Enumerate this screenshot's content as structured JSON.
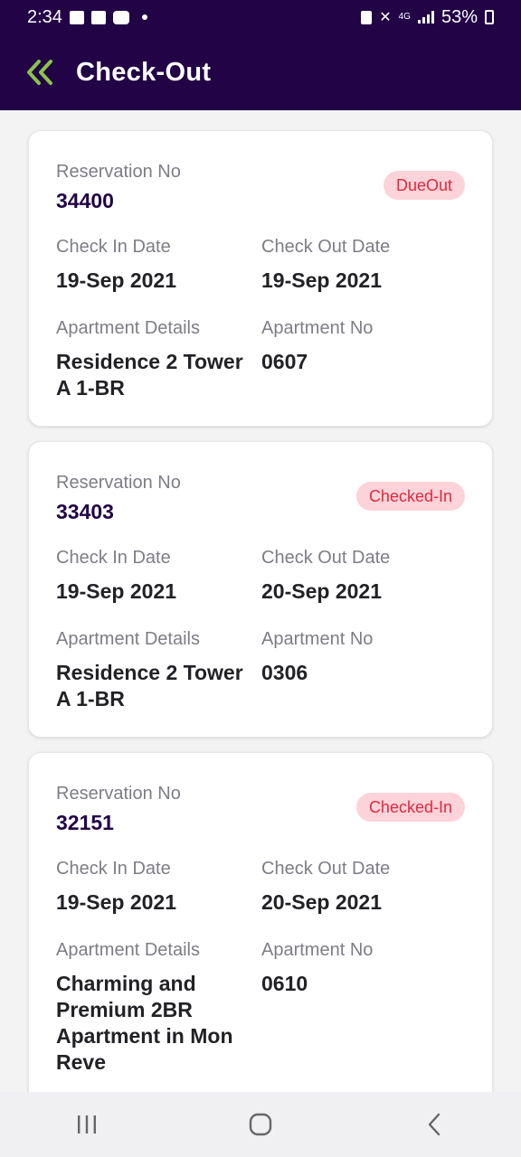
{
  "status_bar": {
    "time": "2:34",
    "network": "4G",
    "battery": "53%"
  },
  "header": {
    "title": "Check-Out",
    "back_icon": "double-chevron-left-icon",
    "accent_color": "#8bc34a",
    "bg_color": "#220446"
  },
  "labels": {
    "reservation_no": "Reservation No",
    "check_in_date": "Check In Date",
    "check_out_date": "Check Out Date",
    "apartment_details": "Apartment Details",
    "apartment_no": "Apartment No"
  },
  "reservations": [
    {
      "reservation_no": "34400",
      "status": "DueOut",
      "check_in": "19-Sep 2021",
      "check_out": "19-Sep 2021",
      "apartment_details_lines": [
        "Residence 2 Tower",
        "A 1-BR"
      ],
      "apartment_no": "0607"
    },
    {
      "reservation_no": "33403",
      "status": "Checked-In",
      "check_in": "19-Sep 2021",
      "check_out": "20-Sep 2021",
      "apartment_details_lines": [
        "Residence 2 Tower",
        "A 1-BR"
      ],
      "apartment_no": "0306"
    },
    {
      "reservation_no": "32151",
      "status": "Checked-In",
      "check_in": "19-Sep 2021",
      "check_out": "20-Sep 2021",
      "apartment_details_lines": [
        "Charming and",
        "Premium 2BR",
        "Apartment in Mon",
        "Reve"
      ],
      "apartment_no": "0610"
    }
  ],
  "nav": {
    "recents_icon": "recents-icon",
    "home_icon": "home-icon",
    "back_icon": "back-icon"
  }
}
